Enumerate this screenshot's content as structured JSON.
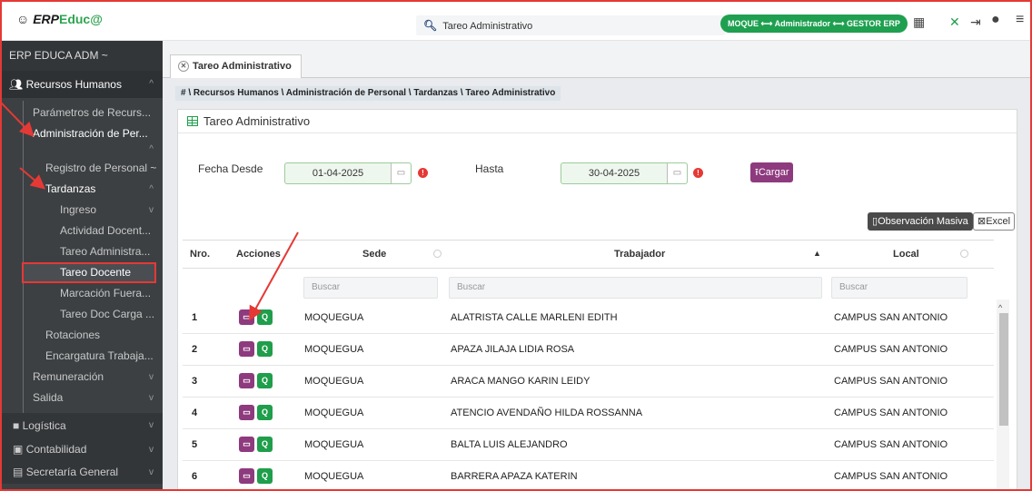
{
  "app": {
    "logo_prefix": "ERP",
    "logo_main": "Educ@",
    "search_value": "Tareo Administrativo",
    "user_pill": "MOQUE ⟷ Administrador ⟷ GESTOR ERP"
  },
  "sidebar": {
    "header": "ERP EDUCA ADM ~",
    "section": "Recursos Humanos",
    "items": [
      "Parámetros de Recurs...",
      "Administración de Per...",
      "Registro de Personal ~",
      "Tardanzas",
      "Ingreso",
      "Actividad Docent...",
      "Tareo Administra...",
      "Tareo Docente",
      "Marcación Fuera...",
      "Tareo Doc Carga ...",
      "Rotaciones",
      "Encargatura Trabaja...",
      "Remuneración",
      "Salida",
      "Logística",
      "Contabilidad",
      "Secretaría General"
    ]
  },
  "tab": {
    "label": "Tareo Administrativo"
  },
  "breadcrumb": "# \\ Recursos Humanos \\ Administración de Personal \\ Tardanzas \\ Tareo Administrativo",
  "panel": {
    "title": "Tareo Administrativo",
    "fecha_desde_label": "Fecha Desde",
    "fecha_desde_value": "01-04-2025",
    "hasta_label": "Hasta",
    "hasta_value": "30-04-2025",
    "cargar_label": "Cargar",
    "obs_label": "Observación Masiva",
    "excel_label": "Excel"
  },
  "table": {
    "headers": {
      "nro": "Nro.",
      "acciones": "Acciones",
      "sede": "Sede",
      "trabajador": "Trabajador",
      "local": "Local"
    },
    "filter_placeholder": "Buscar",
    "rows": [
      {
        "nro": "1",
        "sede": "MOQUEGUA",
        "trabajador": "ALATRISTA CALLE MARLENI EDITH",
        "local": "CAMPUS SAN ANTONIO"
      },
      {
        "nro": "2",
        "sede": "MOQUEGUA",
        "trabajador": "APAZA JILAJA LIDIA ROSA",
        "local": "CAMPUS SAN ANTONIO"
      },
      {
        "nro": "3",
        "sede": "MOQUEGUA",
        "trabajador": "ARACA MANGO KARIN LEIDY",
        "local": "CAMPUS SAN ANTONIO"
      },
      {
        "nro": "4",
        "sede": "MOQUEGUA",
        "trabajador": "ATENCIO AVENDAÑO HILDA ROSSANNA",
        "local": "CAMPUS SAN ANTONIO"
      },
      {
        "nro": "5",
        "sede": "MOQUEGUA",
        "trabajador": "BALTA LUIS ALEJANDRO",
        "local": "CAMPUS SAN ANTONIO"
      },
      {
        "nro": "6",
        "sede": "MOQUEGUA",
        "trabajador": "BARRERA APAZA KATERIN",
        "local": "CAMPUS SAN ANTONIO"
      }
    ]
  },
  "colors": {
    "accent_green": "#1f9e4b",
    "accent_purple": "#8e3a7e",
    "annotation_red": "#e53935"
  }
}
